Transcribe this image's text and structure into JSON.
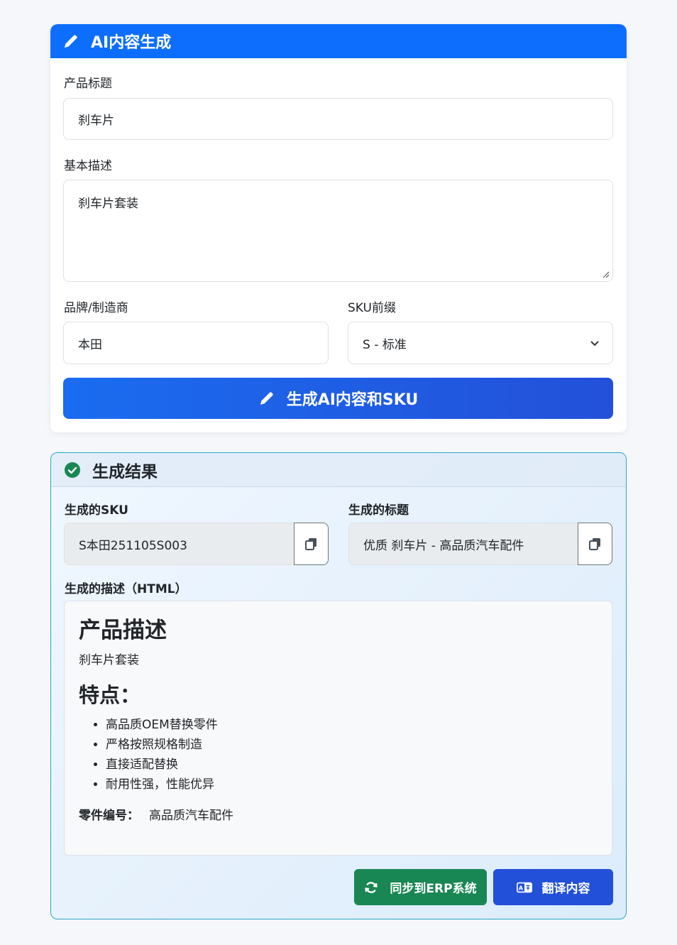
{
  "generator": {
    "header_title": "AI内容生成",
    "product_title_label": "产品标题",
    "product_title_value": "刹车片",
    "basic_desc_label": "基本描述",
    "basic_desc_value": "刹车片套装",
    "brand_label": "品牌/制造商",
    "brand_value": "本田",
    "sku_prefix_label": "SKU前缀",
    "sku_prefix_value": "S - 标准",
    "generate_button": "生成AI内容和SKU"
  },
  "result": {
    "header_title": "生成结果",
    "sku_label": "生成的SKU",
    "sku_value": "S本田251105S003",
    "title_label": "生成的标题",
    "title_value": "优质 刹车片 - 高品质汽车配件",
    "desc_label": "生成的描述（HTML）",
    "desc": {
      "heading": "产品描述",
      "text": "刹车片套装",
      "features_heading": "特点：",
      "features": [
        "高品质OEM替换零件",
        "严格按照规格制造",
        "直接适配替换",
        "耐用性强，性能优异"
      ],
      "part_label": "零件编号：",
      "part_value": "高品质汽车配件"
    },
    "sync_button": "同步到ERP系统",
    "translate_button": "翻译内容"
  },
  "colors": {
    "primary": "#0d6efd",
    "success": "#198754",
    "result_border": "#2aa6c8"
  },
  "icons": [
    "pencil-icon",
    "check-circle-icon",
    "copy-icon",
    "chevron-down-icon",
    "sync-icon",
    "translate-icon"
  ]
}
